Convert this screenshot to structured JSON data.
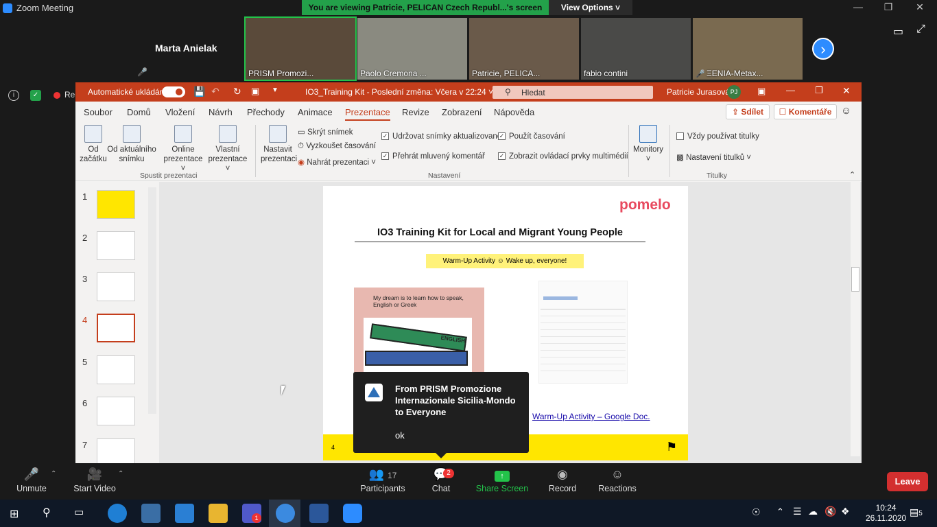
{
  "zoom": {
    "title": "Zoom Meeting",
    "share_banner": "You are viewing Patricie, PELICAN Czech Republ...'s screen",
    "view_options": "View Options",
    "featured_name": "Marta Anielak",
    "participants_tiles": [
      {
        "name": "PRISM Promozi..."
      },
      {
        "name": "Paolo Cremona ..."
      },
      {
        "name": "Patricie, PELICA..."
      },
      {
        "name": "fabio contini"
      },
      {
        "name": "ΞENIA-Metax..."
      }
    ],
    "recording_label": "Recording"
  },
  "ppt": {
    "autosave": "Automatické ukládání",
    "doc_title": "IO3_Training Kit  -  Poslední změna: Včera v 22:24",
    "search_placeholder": "Hledat",
    "user_name": "Patricie Jurasová",
    "user_initials": "PJ",
    "tabs": [
      "Soubor",
      "Domů",
      "Vložení",
      "Návrh",
      "Přechody",
      "Animace",
      "Prezentace",
      "Revize",
      "Zobrazení",
      "Nápověda"
    ],
    "share": "Sdílet",
    "comments": "Komentáře",
    "ribbon": {
      "from_start_1": "Od",
      "from_start_2": "začátku",
      "from_current_1": "Od aktuálního",
      "from_current_2": "snímku",
      "online_1": "Online",
      "online_2": "prezentace",
      "custom_1": "Vlastní",
      "custom_2": "prezentace",
      "group_start": "Spustit prezentaci",
      "setup_1": "Nastavit",
      "setup_2": "prezentaci",
      "hide_slide": "Skrýt snímek",
      "rehearse": "Vyzkoušet časování",
      "record": "Nahrát prezentaci",
      "keep_updated": "Udržovat snímky aktualizované",
      "play_narration": "Přehrát mluvený komentář",
      "use_timing": "Použít časování",
      "show_media": "Zobrazit ovládací prvky multimédií",
      "group_setup": "Nastavení",
      "monitors": "Monitory",
      "always_subtitles": "Vždy používat titulky",
      "subtitle_settings": "Nastavení titulků",
      "group_subtitles": "Titulky"
    },
    "thumb_numbers": [
      "1",
      "2",
      "3",
      "4",
      "5",
      "6",
      "7"
    ],
    "slide": {
      "logo": "pomelo",
      "title": "IO3 Training Kit for Local and Migrant Young People",
      "subtitle": "Warm-Up Activity ☺ Wake up, everyone!",
      "image_text": "My dream is to learn how to speak, English or Greek",
      "book_label": "ENGLISH",
      "link": "Warm-Up Activity – Google Doc.",
      "page_number": "4"
    }
  },
  "popup": {
    "from": "From PRISM Promozione Internazionale Sicilia-Mondo to Everyone",
    "message": "ok"
  },
  "toolbar": {
    "unmute": "Unmute",
    "start_video": "Start Video",
    "participants": "Participants",
    "participants_count": "17",
    "chat": "Chat",
    "chat_badge": "2",
    "share_screen": "Share Screen",
    "record": "Record",
    "reactions": "Reactions",
    "leave": "Leave"
  },
  "taskbar": {
    "time": "10:24",
    "date": "26.11.2020",
    "notifications": "5",
    "teams_badge": "1"
  },
  "colors": {
    "ppt_accent": "#c43e1c",
    "zoom_green": "#23a14a",
    "zoom_blue": "#2d8cff",
    "leave_red": "#d32f2f"
  }
}
